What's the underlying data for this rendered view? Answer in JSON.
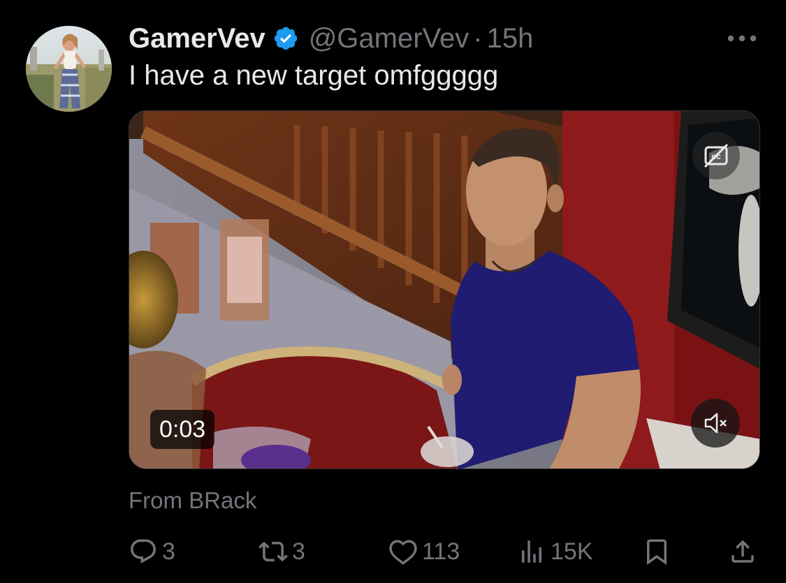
{
  "tweet": {
    "author": {
      "display_name": "GamerVev",
      "handle": "@GamerVev",
      "verified": true
    },
    "time_separator": "·",
    "time": "15h",
    "text": "I have a new target omfggggg",
    "media": {
      "type": "video",
      "timestamp": "0:03",
      "muted": true,
      "captions_icon": "closed-captions-off-icon"
    },
    "source": "From BRack",
    "actions": {
      "replies": "3",
      "reposts": "3",
      "likes": "113",
      "views": "15K"
    }
  },
  "colors": {
    "background": "#000000",
    "primary_text": "#e7e9ea",
    "secondary_text": "#71767b",
    "verified_badge": "#1d9bf0"
  },
  "icons": {
    "more": "more-horizontal-icon",
    "reply": "reply-bubble-icon",
    "repost": "repost-icon",
    "like": "heart-icon",
    "views": "views-bar-chart-icon",
    "bookmark": "bookmark-icon",
    "share": "share-upload-icon",
    "mute": "speaker-muted-icon"
  }
}
